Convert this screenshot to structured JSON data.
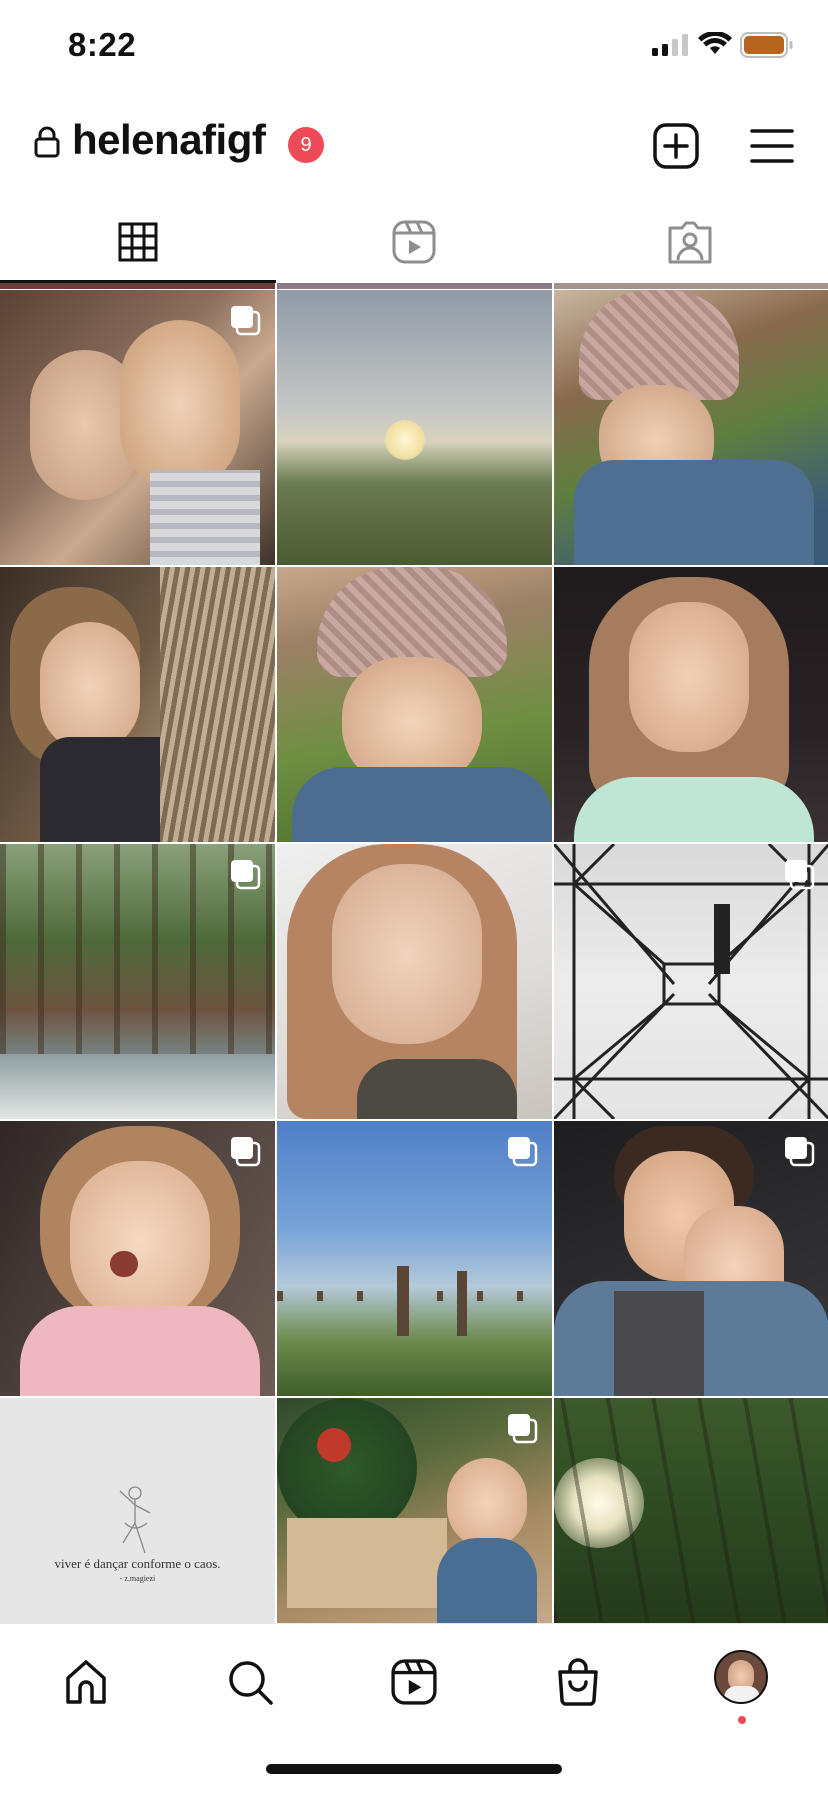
{
  "status": {
    "time": "8:22",
    "battery_color": "#b5651d"
  },
  "header": {
    "username": "helenafigf",
    "notification_count": "9",
    "badge_color": "#ed4956",
    "icons": [
      "lock-icon",
      "new-post-icon",
      "menu-icon"
    ]
  },
  "tabs": [
    {
      "name": "posts-grid",
      "icon": "grid-icon",
      "active": true
    },
    {
      "name": "reels",
      "icon": "reels-icon",
      "active": false
    },
    {
      "name": "tagged",
      "icon": "tagged-icon",
      "active": false
    }
  ],
  "posts": [
    {
      "description": "selfie of two women",
      "multi": true
    },
    {
      "description": "sunrise over field",
      "multi": false
    },
    {
      "description": "girl in knit hat making peace sign",
      "multi": false
    },
    {
      "description": "girl by hammock",
      "multi": false
    },
    {
      "description": "girl in knit hat smiling",
      "multi": false
    },
    {
      "description": "woman portrait dark background",
      "multi": false
    },
    {
      "description": "forest stream",
      "multi": true
    },
    {
      "description": "woman close-up portrait",
      "multi": false
    },
    {
      "description": "electric tower from below",
      "multi": true
    },
    {
      "description": "excited little girl clapping",
      "multi": true
    },
    {
      "description": "blue sky over fence",
      "multi": true
    },
    {
      "description": "couple portrait",
      "multi": true
    },
    {
      "description": "text quote drawing",
      "multi": false
    },
    {
      "description": "girl by christmas tree",
      "multi": true
    },
    {
      "description": "forest trees with sunlight",
      "multi": false
    }
  ],
  "quote_post": {
    "text": "viver é dançar conforme o caos.",
    "author": "- z.magiezi"
  },
  "bottom_nav": {
    "items": [
      "home-icon",
      "search-icon",
      "reels-icon",
      "shop-icon",
      "profile-avatar"
    ]
  }
}
